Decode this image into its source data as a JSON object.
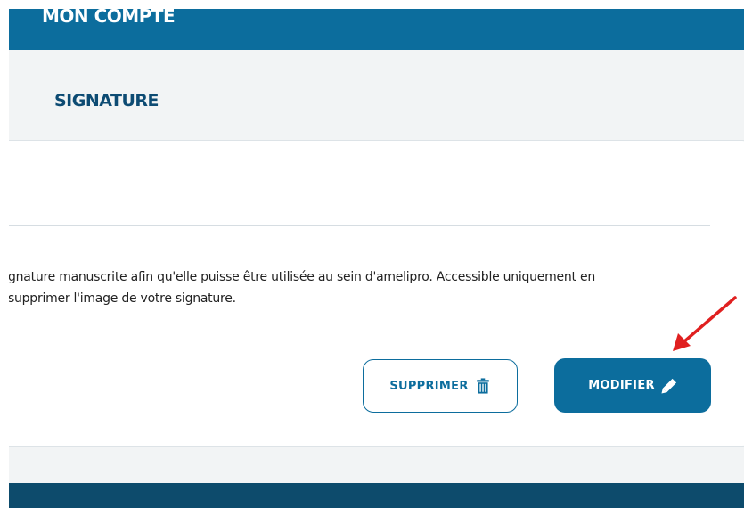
{
  "header": {
    "title": "MON COMPTE"
  },
  "section": {
    "title": "SIGNATURE"
  },
  "card": {
    "description_line1": "gnature manuscrite afin qu'elle puisse être utilisée au sein d'amelipro. Accessible uniquement en",
    "description_line2": "supprimer l'image de votre signature."
  },
  "buttons": {
    "delete_label": "SUPPRIMER",
    "delete_icon": "trash-icon",
    "edit_label": "MODIFIER",
    "edit_icon": "pencil-icon"
  },
  "annotation": {
    "arrow_color": "#e02020"
  },
  "colors": {
    "brand_blue": "#0c6d9d",
    "dark_navy": "#0d4b6c",
    "title_navy": "#0d4b73",
    "background": "#f2f4f5"
  }
}
